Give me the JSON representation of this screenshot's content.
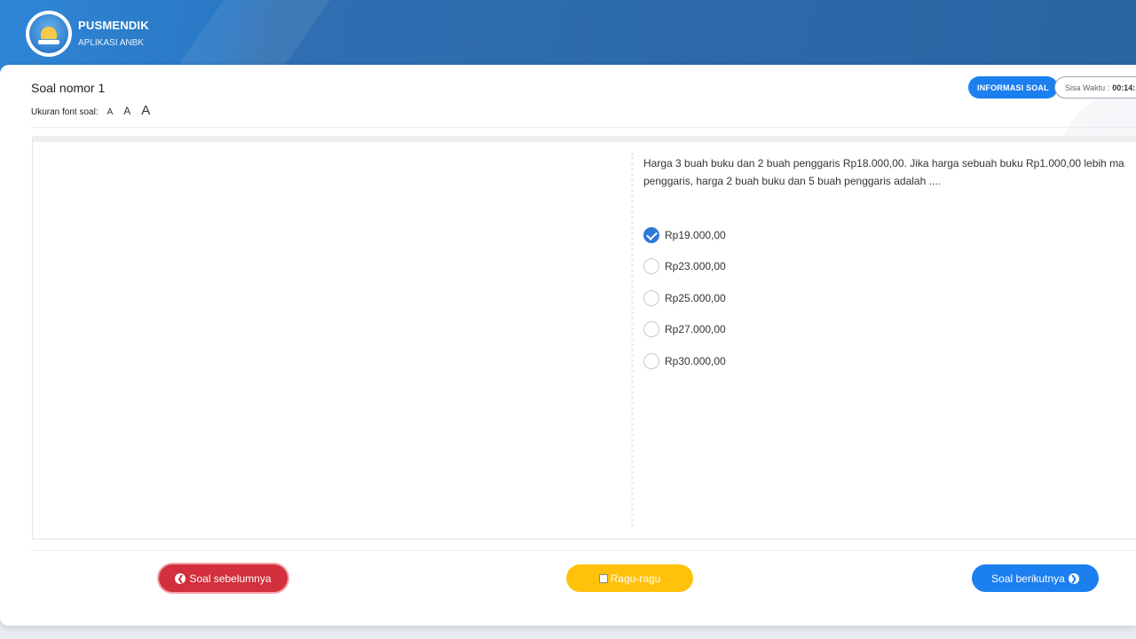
{
  "header": {
    "title": "PUSMENDIK",
    "subtitle": "APLIKASI ANBK",
    "logo_icon": "tut-wuri-handayani-logo"
  },
  "question": {
    "title": "Soal nomor 1",
    "font_size_label": "Ukuran font soal:",
    "font_sizes": [
      "A",
      "A",
      "A"
    ],
    "info_button": "INFORMASI SOAL",
    "timer_label": "Sisa Waktu :",
    "timer_value": "00:14:",
    "text_line1": "Harga 3 buah buku dan 2 buah penggaris Rp18.000,00. Jika harga sebuah buku Rp1.000,00 lebih ma",
    "text_line2": "penggaris, harga 2 buah buku dan 5 buah penggaris adalah ....",
    "options": [
      {
        "label": "Rp19.000,00",
        "selected": true
      },
      {
        "label": "Rp23.000,00",
        "selected": false
      },
      {
        "label": "Rp25.000,00",
        "selected": false
      },
      {
        "label": "Rp27.000,00",
        "selected": false
      },
      {
        "label": "Rp30.000,00",
        "selected": false
      }
    ]
  },
  "nav": {
    "prev_label": "Soal sebelumnya",
    "ragu_label": "Ragu-ragu",
    "next_label": "Soal berikutnya",
    "prev_icon": "chevron-left-circle-icon",
    "next_icon": "chevron-right-circle-icon",
    "ragu_icon": "checkbox-icon"
  },
  "colors": {
    "header": "#2c6aaa",
    "primary": "#1b7ff0",
    "danger": "#d32f3c",
    "warning": "#ffc10a",
    "checked": "#2f7ad8"
  }
}
